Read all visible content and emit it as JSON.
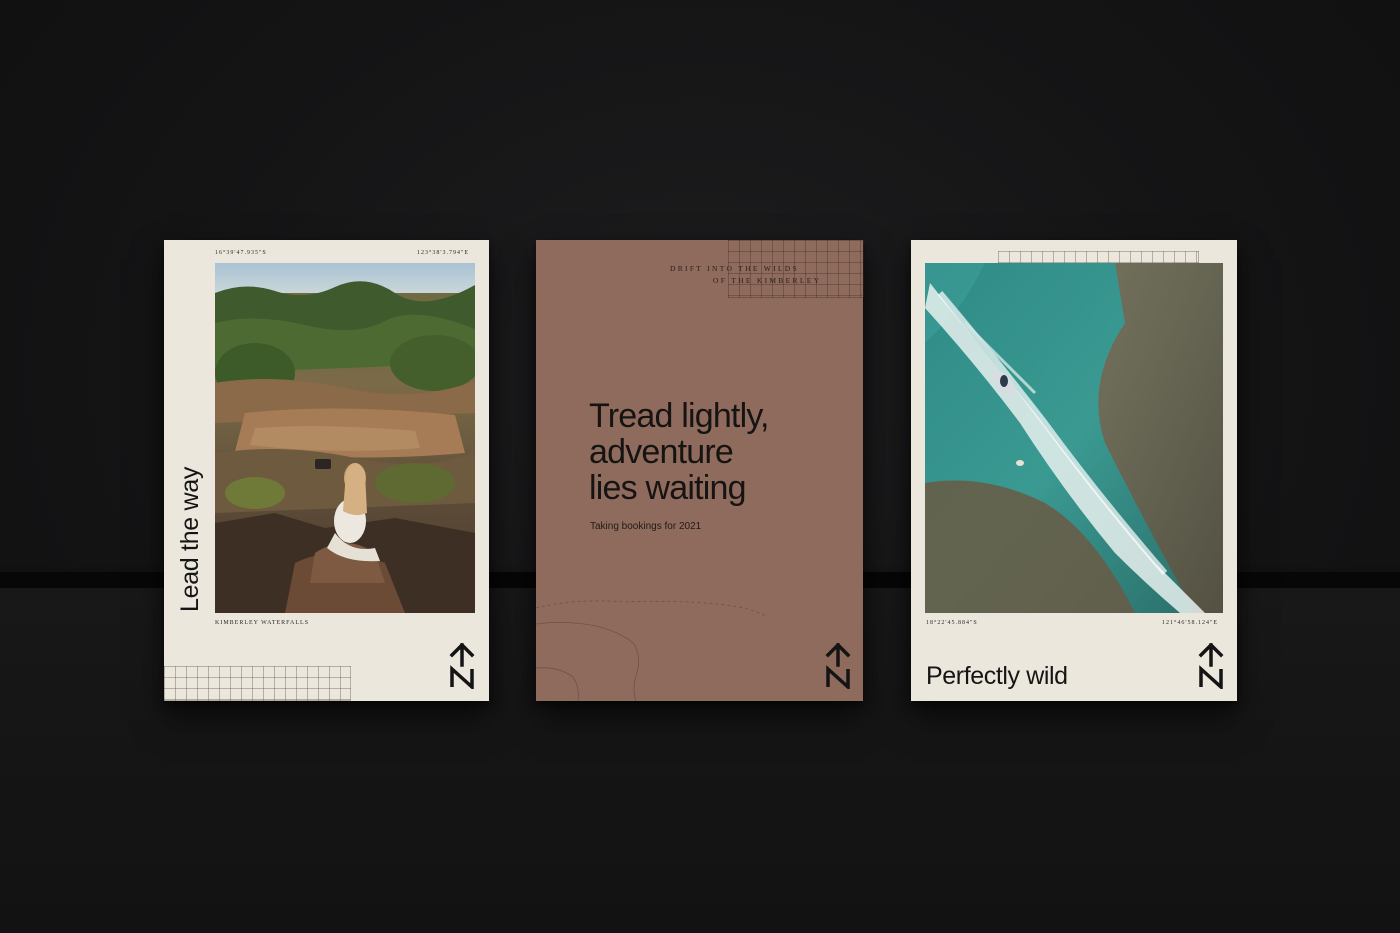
{
  "cards": {
    "left": {
      "coord_lat": "16°39'47.935\"S",
      "coord_lon": "123°38'3.794\"E",
      "caption": "KIMBERLEY WATERFALLS",
      "title": "Lead the way",
      "logo_icon": "north-arrow-n-icon",
      "background_color": "#ece7dc"
    },
    "middle": {
      "tagline_line1": "DRIFT INTO THE WILDS",
      "tagline_line2": "OF THE KIMBERLEY",
      "headline_line1": "Tread lightly,",
      "headline_line2": "adventure",
      "headline_line3": "lies waiting",
      "subline": "Taking bookings for 2021",
      "logo_icon": "north-arrow-n-icon",
      "background_color": "#8f6b5d"
    },
    "right": {
      "coord_lat": "18°22'45.884\"S",
      "coord_lon": "121°46'58.124\"E",
      "title": "Perfectly wild",
      "logo_icon": "north-arrow-n-icon",
      "background_color": "#ece7dc"
    }
  }
}
